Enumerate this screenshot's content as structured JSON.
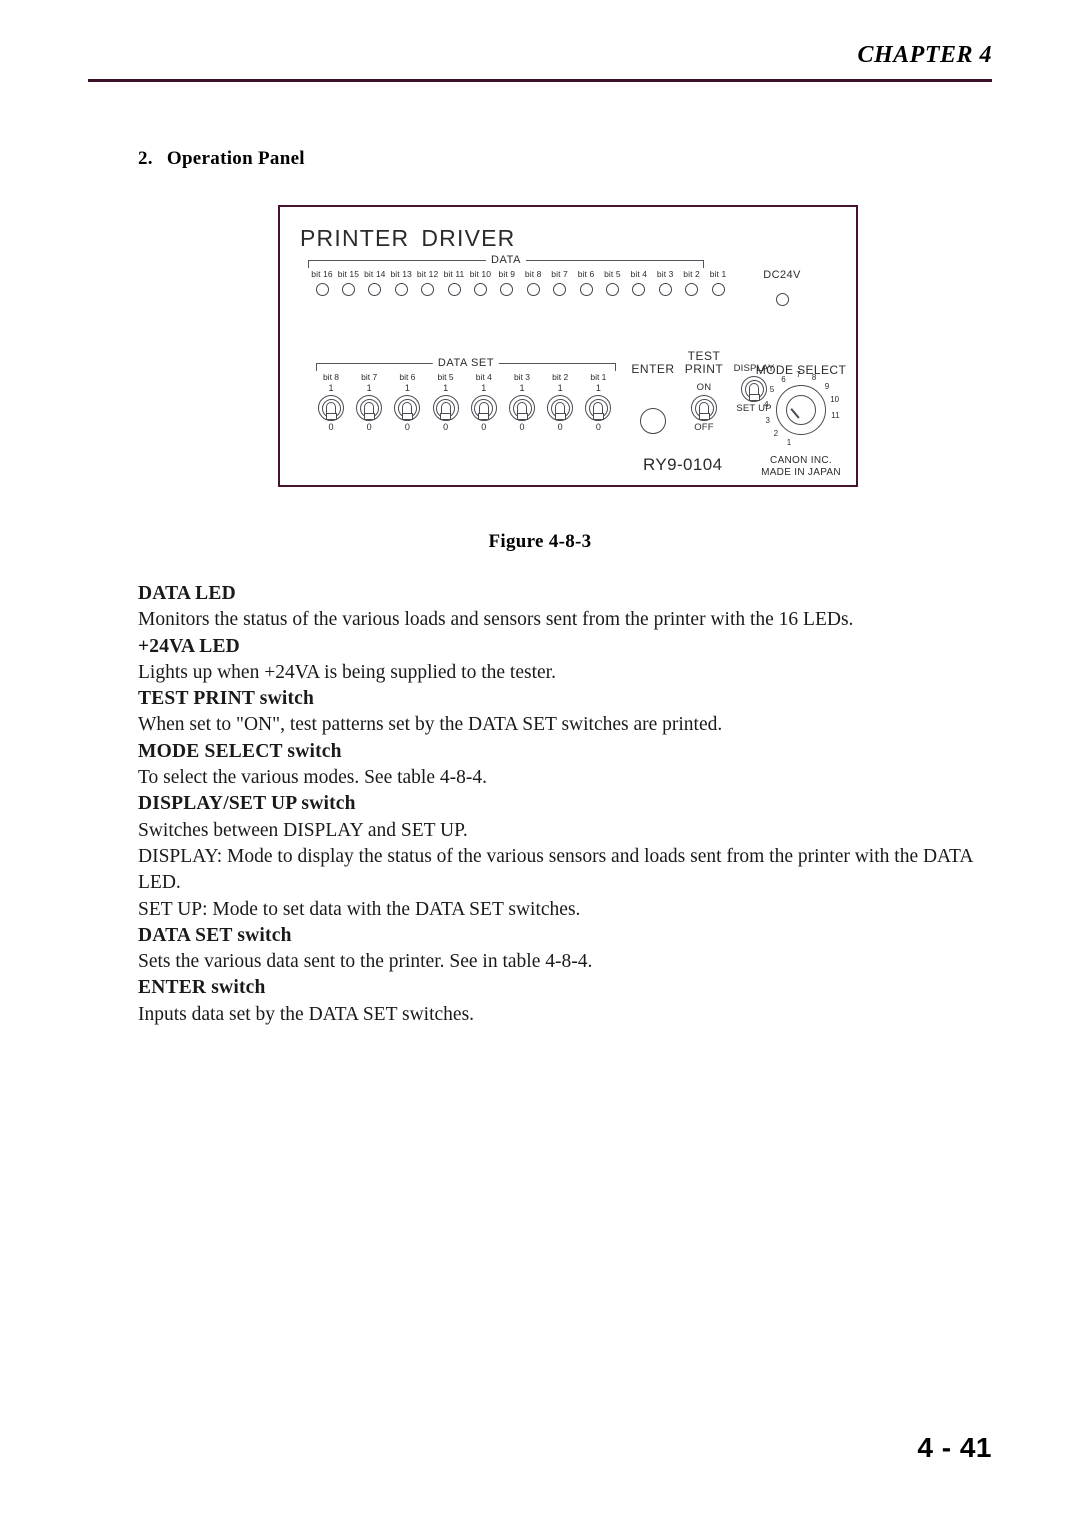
{
  "header": {
    "chapter_title": "CHAPTER 4"
  },
  "section": {
    "number": "2.",
    "title": "Operation Panel"
  },
  "figure": {
    "caption": "Figure 4-8-3",
    "panel": {
      "brand_word1": "PRINTER",
      "brand_word2": "DRIVER",
      "model_number": "RY9-0104",
      "credit_line1": "CANON  INC.",
      "credit_line2": "MADE  IN  JAPAN",
      "data_led": {
        "bracket_label": "DATA",
        "bits": [
          "bit 16",
          "bit 15",
          "bit 14",
          "bit 13",
          "bit 12",
          "bit 11",
          "bit 10",
          "bit 9",
          "bit 8",
          "bit 7",
          "bit 6",
          "bit 5",
          "bit 4",
          "bit 3",
          "bit 2",
          "bit 1"
        ]
      },
      "dc24v": {
        "label": "DC24V"
      },
      "data_set": {
        "bracket_label": "DATA  SET",
        "bits": [
          "bit 8",
          "bit 7",
          "bit 6",
          "bit 5",
          "bit 4",
          "bit 3",
          "bit 2",
          "bit 1"
        ],
        "high_label": "1",
        "low_label": "0"
      },
      "enter": {
        "title": "ENTER"
      },
      "test_print": {
        "title_line1": "TEST",
        "title_line2": "PRINT",
        "on_label": "ON",
        "off_label": "OFF"
      },
      "display_setup": {
        "top_label": "DISPLAY",
        "bottom_label": "SET UP"
      },
      "mode_select": {
        "title": "MODE SELECT",
        "positions": [
          "1",
          "2",
          "3",
          "4",
          "5",
          "6",
          "7",
          "8",
          "9",
          "10",
          "11"
        ],
        "selected": "1"
      }
    }
  },
  "body": {
    "entries": [
      {
        "term": "DATA LED",
        "text": "Monitors the status of the various loads and sensors sent from the printer with the 16 LEDs."
      },
      {
        "term": "+24VA LED",
        "text": "Lights up when +24VA is being supplied to the tester."
      },
      {
        "term": "TEST PRINT switch",
        "text": "When set to \"ON\", test patterns set by the DATA SET switches are printed."
      },
      {
        "term": "MODE SELECT switch",
        "text": "To select the various modes. See table 4-8-4."
      },
      {
        "term": "DISPLAY/SET UP switch",
        "text": "Switches between DISPLAY and SET UP.",
        "text2": "DISPLAY: Mode to display the status of the various sensors and loads sent from the printer with the DATA LED.",
        "text3": "SET UP: Mode to set data with the DATA SET switches."
      },
      {
        "term": "DATA SET switch",
        "text": "Sets the various data sent to the printer.  See in table 4-8-4."
      },
      {
        "term": "ENTER switch",
        "text": "Inputs data set by the DATA SET switches."
      }
    ]
  },
  "footer": {
    "page_number": "4 - 41"
  },
  "colors": {
    "rule": "#3c1028",
    "panel_border": "#46122f",
    "line_art": "#4a4a54"
  }
}
